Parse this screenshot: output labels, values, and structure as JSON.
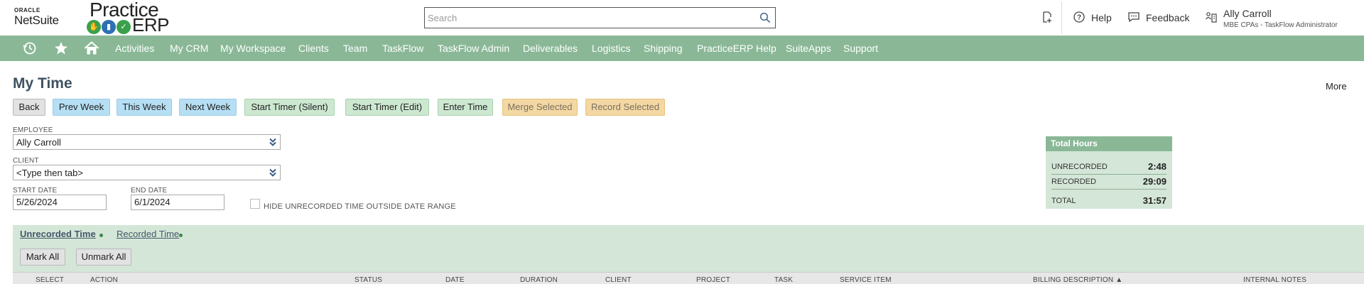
{
  "header": {
    "oracle_label": "ORACLE",
    "netsuite_label": "NetSuite",
    "practice_label": "Practice",
    "erp_label": "ERP",
    "search_placeholder": "Search",
    "help_label": "Help",
    "feedback_label": "Feedback",
    "user_name": "Ally Carroll",
    "user_role": "MBE CPAs - TaskFlow Administrator"
  },
  "nav": {
    "items": [
      "Activities",
      "My CRM",
      "My Workspace",
      "Clients",
      "Team",
      "TaskFlow",
      "TaskFlow Admin",
      "Deliverables",
      "Logistics",
      "Shipping",
      "PracticeERP Help",
      "SuiteApps",
      "Support"
    ]
  },
  "page": {
    "title": "My Time",
    "more_label": "More"
  },
  "buttons": {
    "back": "Back",
    "prev_week": "Prev Week",
    "this_week": "This Week",
    "next_week": "Next Week",
    "start_timer_silent": "Start Timer (Silent)",
    "start_timer_edit": "Start Timer (Edit)",
    "enter_time": "Enter Time",
    "merge_selected": "Merge Selected",
    "record_selected": "Record Selected"
  },
  "form": {
    "employee_label": "EMPLOYEE",
    "employee_value": "Ally Carroll",
    "client_label": "CLIENT",
    "client_value": "<Type then tab>",
    "start_date_label": "START DATE",
    "start_date_value": "5/26/2024",
    "end_date_label": "END DATE",
    "end_date_value": "6/1/2024",
    "hide_checkbox_label": "HIDE UNRECORDED TIME OUTSIDE DATE RANGE",
    "hide_checked": false
  },
  "total_hours": {
    "title": "Total Hours",
    "unrecorded_label": "UNRECORDED",
    "unrecorded_value": "2:48",
    "recorded_label": "RECORDED",
    "recorded_value": "29:09",
    "total_label": "TOTAL",
    "total_value": "31:57"
  },
  "subtabs": {
    "unrecorded": "Unrecorded Time",
    "recorded": "Recorded Time",
    "mark_all": "Mark All",
    "unmark_all": "Unmark All"
  },
  "table": {
    "columns": [
      "SELECT",
      "ACTION",
      "STATUS",
      "DATE",
      "DURATION",
      "CLIENT",
      "PROJECT",
      "TASK",
      "SERVICE ITEM",
      "BILLING DESCRIPTION ▲",
      "INTERNAL NOTES"
    ]
  },
  "colors": {
    "nav_green": "#8ab897",
    "panel_green": "#d4e6d7",
    "title_color": "#3f5261",
    "blue_button": "#b6dff4",
    "green_button": "#cde8d1",
    "orange_button": "#f4d8a3"
  },
  "icons": [
    "search-icon",
    "new-page-icon",
    "help-icon",
    "feedback-icon",
    "user-org-icon",
    "recent-history-icon",
    "star-icon",
    "home-icon",
    "double-chevron-down-icon"
  ]
}
